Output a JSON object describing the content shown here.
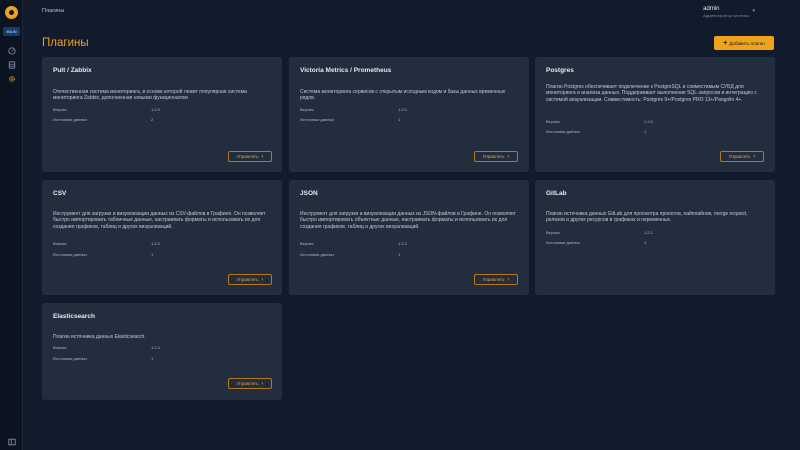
{
  "sidebar": {
    "workspace_badge": "MAIN",
    "icons": [
      "dashboard-icon",
      "database-icon",
      "gear-icon",
      "collapse-icon"
    ]
  },
  "header": {
    "breadcrumb": "Плагины",
    "user_name": "admin",
    "user_role": "Администратор системы",
    "caret": "▾"
  },
  "page": {
    "title": "Плагины",
    "add_button": "Добавить плагин",
    "add_icon": "+"
  },
  "labels": {
    "version": "Версия",
    "sources": "Источники данных",
    "manage": "Управлять",
    "manage_icon": "›"
  },
  "plugins": [
    {
      "name": "Pult / Zabbix",
      "description": "Отечественная система мониторинга, в основе которой лежит популярная система мониторинга Zabbix, дополненная новыми функционалом",
      "version": "1.2.0",
      "sources": "2"
    },
    {
      "name": "Victoria Metrics / Prometheus",
      "description": "Система мониторинга сервисов с открытым исходным кодом и базы данных временных рядов.",
      "version": "1.2.0",
      "sources": "1"
    },
    {
      "name": "Postgres",
      "description": "Плагин Postgres обеспечивает подключение к PostgreSQL и совместимым СУБД для мониторинга и анализа данных. Поддерживает выполнение SQL-запросов и интеграцию с системой визуализации. Совместимость: Postgres 9+/Postgres PRO 13+/Pangolin 4+.",
      "version": "1.2.0",
      "sources": "1"
    },
    {
      "name": "CSV",
      "description": "Инструмент для загрузки и визуализации данных из CSV-файлов в Графине. Он позволяет быстро импортировать табличные данные, настраивать форматы и использовать их для создания графиков, таблиц и других визуализаций.",
      "version": "1.2.0",
      "sources": "1"
    },
    {
      "name": "JSON",
      "description": "Инструмент для загрузки и визуализации данных из JSON-файлов в Графине. Он позволяет быстро импортировать объектные данные, настраивать форматы и использовать их для создания графиков, таблиц и других визуализаций.",
      "version": "1.2.3",
      "sources": "1"
    },
    {
      "name": "GitLab",
      "description": "Плагин источника данных GitLab для просмотра проектов, пайплайнов, merge request, релизов и других ресурсов в графиках и переменных.",
      "version": "1.2.1",
      "sources": "1"
    },
    {
      "name": "Elasticsearch",
      "description": "Плагин источника данных Elasticsearch.",
      "version": "1.2.4",
      "sources": "1"
    }
  ]
}
